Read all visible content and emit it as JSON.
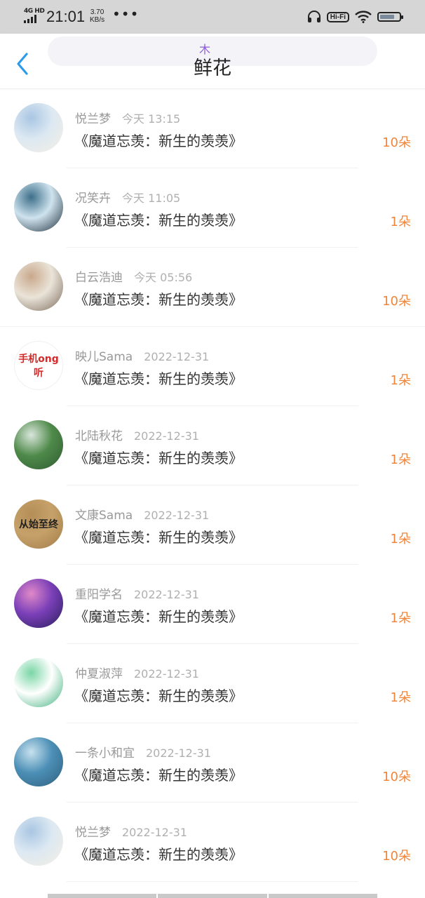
{
  "status_bar": {
    "network": "4G HD",
    "time": "21:01",
    "speed_value": "3.70",
    "speed_unit": "KB/s",
    "more": "•••",
    "hifi": "Hi-Fi",
    "battery_level": 0.75
  },
  "header": {
    "title": "鲜花",
    "overlay_glyph": "木"
  },
  "items": [
    {
      "name": "悦兰梦",
      "time": "今天 13:15",
      "book": "《魔道忘羡：新生的羡羡》",
      "count": "10朵",
      "avatar_label": "",
      "avatar_colors": [
        "#dce8f2",
        "#a9c6e3",
        "#f4efe4"
      ]
    },
    {
      "name": "况笑卉",
      "time": "今天 11:05",
      "book": "《魔道忘羡：新生的羡羡》",
      "count": "1朵",
      "avatar_label": "",
      "avatar_colors": [
        "#cfe3ee",
        "#3d6f8a",
        "#1c2f3b"
      ]
    },
    {
      "name": "白云浩迪",
      "time": "今天 05:56",
      "book": "《魔道忘羡：新生的羡羡》",
      "count": "10朵",
      "avatar_label": "",
      "avatar_colors": [
        "#eae4d8",
        "#c9a88c",
        "#7c6a5c"
      ]
    },
    {
      "name": "映儿Sama",
      "time": "2022-12-31",
      "book": "《魔道忘羡：新生的羡羡》",
      "count": "1朵",
      "avatar_label": "手机ong听",
      "avatar_colors": [
        "#ffffff",
        "#ffffff",
        "#ffffff"
      ]
    },
    {
      "name": "北陆秋花",
      "time": "2022-12-31",
      "book": "《魔道忘羡：新生的羡羡》",
      "count": "1朵",
      "avatar_label": "",
      "avatar_colors": [
        "#4f8a4a",
        "#d9e6dc",
        "#2f5a32"
      ]
    },
    {
      "name": "文康Sama",
      "time": "2022-12-31",
      "book": "《魔道忘羡：新生的羡羡》",
      "count": "1朵",
      "avatar_label": "从始至终",
      "avatar_colors": [
        "#c6a16a",
        "#b58e57",
        "#a37c47"
      ]
    },
    {
      "name": "重阳学名",
      "time": "2022-12-31",
      "book": "《魔道忘羡：新生的羡羡》",
      "count": "1朵",
      "avatar_label": "",
      "avatar_colors": [
        "#7a3fb8",
        "#e089c8",
        "#2a1f5a"
      ]
    },
    {
      "name": "仲夏淑萍",
      "time": "2022-12-31",
      "book": "《魔道忘羡：新生的羡羡》",
      "count": "1朵",
      "avatar_label": "",
      "avatar_colors": [
        "#ffffff",
        "#7ad6a6",
        "#3eb07c"
      ]
    },
    {
      "name": "一条小和宜",
      "time": "2022-12-31",
      "book": "《魔道忘羡：新生的羡羡》",
      "count": "10朵",
      "avatar_label": "",
      "avatar_colors": [
        "#4c8fb6",
        "#c7e1ee",
        "#2f5f7d"
      ]
    },
    {
      "name": "悦兰梦",
      "time": "2022-12-31",
      "book": "《魔道忘羡：新生的羡羡》",
      "count": "10朵",
      "avatar_label": "",
      "avatar_colors": [
        "#dce8f2",
        "#a9c6e3",
        "#f4efe4"
      ]
    }
  ],
  "colors": {
    "accent_back": "#2e9bea",
    "count": "#f08438",
    "name": "#999999",
    "book": "#333333"
  }
}
